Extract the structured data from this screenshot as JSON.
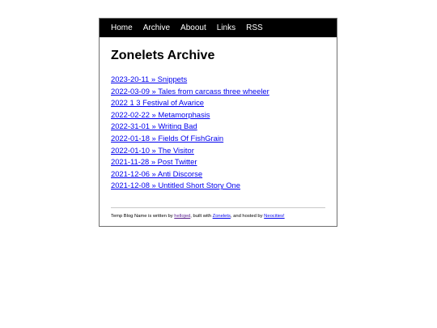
{
  "nav": {
    "items": [
      {
        "label": "Home"
      },
      {
        "label": "Archive"
      },
      {
        "label": "Aboout"
      },
      {
        "label": "Links"
      },
      {
        "label": "RSS"
      }
    ]
  },
  "page_title": "Zonelets Archive",
  "entries": [
    {
      "label": "2023-20-11 » Snippets"
    },
    {
      "label": "2022-03-09 » Tales from carcass three wheeler"
    },
    {
      "label": "2022 1 3 Festival of Avarice"
    },
    {
      "label": "2022-02-22 » Metamorphasis"
    },
    {
      "label": "2022-31-01 » Writing Bad"
    },
    {
      "label": "2022-01-18 » Fields Of FishGrain"
    },
    {
      "label": "2022-01-10 » The Visitor"
    },
    {
      "label": "2021-11-28 » Post Twitter"
    },
    {
      "label": "2021-12-06 » Anti Discorse"
    },
    {
      "label": "2021-12-08 » Untitled Short Story One"
    }
  ],
  "footer": {
    "text_1": "Temp Blog Name is written by ",
    "author_link": "hellojed",
    "text_2": ", built with ",
    "zonelets_link": "Zonelets",
    "text_3": ", and hosted by ",
    "neocities_link": "Neocities!"
  },
  "colors": {
    "nav_background": "#000000",
    "link": "#0000ee",
    "visited_link": "#551a8b"
  }
}
